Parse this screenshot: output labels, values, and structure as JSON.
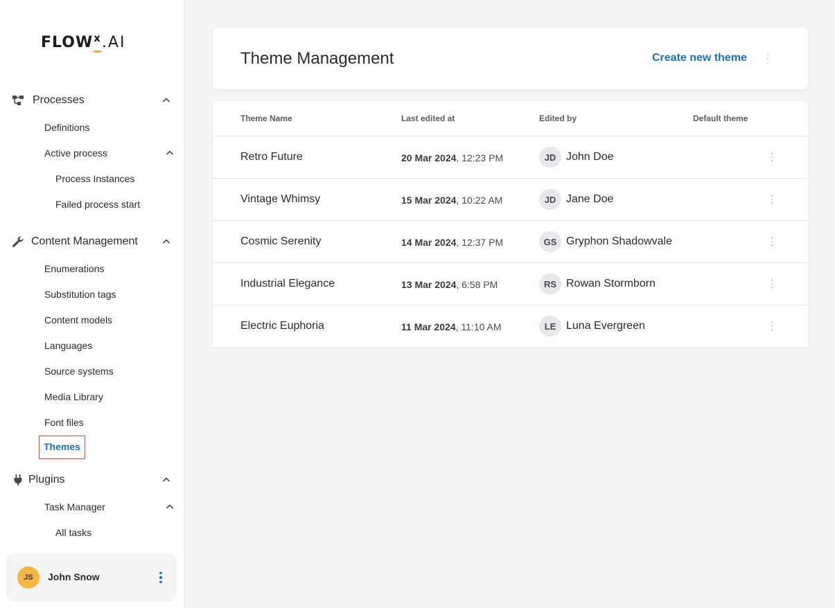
{
  "brand": {
    "logo_main": "FLOW",
    "logo_x": "x",
    "logo_suffix": ".AI",
    "accent": "#f6a93b"
  },
  "sidebar": {
    "sections": [
      {
        "label": "Processes",
        "icon": "process-icon"
      },
      {
        "label": "Content Management",
        "icon": "wrench-icon"
      },
      {
        "label": "Plugins",
        "icon": "plug-icon"
      }
    ],
    "processes_items": {
      "definitions": "Definitions",
      "active_process": "Active process",
      "process_instances": "Process Instances",
      "failed_process_start": "Failed process start"
    },
    "content_items": {
      "enumerations": "Enumerations",
      "substitution_tags": "Substitution tags",
      "content_models": "Content models",
      "languages": "Languages",
      "source_systems": "Source systems",
      "media_library": "Media Library",
      "font_files": "Font files",
      "themes": "Themes"
    },
    "plugins_items": {
      "task_manager": "Task Manager",
      "all_tasks": "All tasks"
    },
    "user": {
      "initials": "JS",
      "name": "John Snow"
    }
  },
  "header": {
    "title": "Theme Management",
    "create_label": "Create new theme"
  },
  "table": {
    "columns": [
      "Theme Name",
      "Last edited at",
      "Edited by",
      "Default theme"
    ],
    "rows": [
      {
        "name": "Retro Future",
        "date": "20 Mar 2024",
        "time": ", 12:23 PM",
        "initials": "JD",
        "editor": "John Doe"
      },
      {
        "name": "Vintage Whimsy",
        "date": "15 Mar 2024",
        "time": ", 10:22 AM",
        "initials": "JD",
        "editor": "Jane Doe"
      },
      {
        "name": "Cosmic Serenity",
        "date": "14 Mar 2024",
        "time": ", 12:37 PM",
        "initials": "GS",
        "editor": "Gryphon Shadowvale"
      },
      {
        "name": "Industrial Elegance",
        "date": "13 Mar 2024",
        "time": ", 6:58 PM",
        "initials": "RS",
        "editor": "Rowan Stormborn"
      },
      {
        "name": "Electric Euphoria",
        "date": "11 Mar 2024",
        "time": ", 11:10 AM",
        "initials": "LE",
        "editor": "Luna Evergreen"
      }
    ]
  },
  "colors": {
    "link": "#1a6fc7",
    "highlight_border": "#d9493d",
    "avatar": "#f6b643"
  }
}
